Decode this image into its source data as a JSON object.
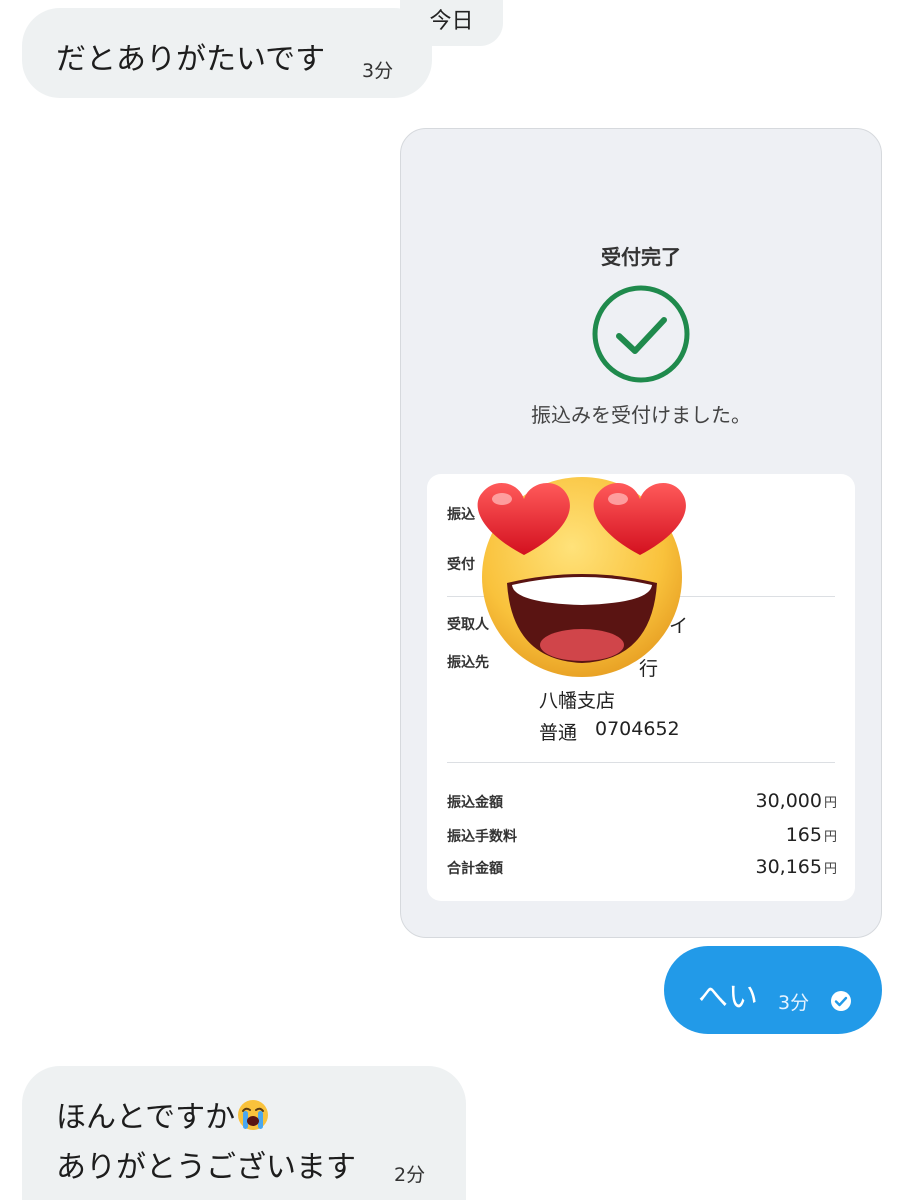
{
  "date_label": "今日",
  "messages": {
    "m1": {
      "text": "だとありがたいです",
      "time": "3分"
    },
    "m2": {
      "text": "へい",
      "time": "3分"
    },
    "m3": {
      "line1": "ほんとですか",
      "line2": "ありがとうございます",
      "time": "2分"
    }
  },
  "receipt": {
    "title": "受付完了",
    "subtitle": "振込みを受付けました。",
    "labels": {
      "transfer_date": "振込",
      "accepted": "受付",
      "recipient": "受取人",
      "destination": "振込先",
      "amount": "振込金額",
      "fee": "振込手数料",
      "total": "合計金額"
    },
    "dest_bank": "行",
    "dest_branch": "八幡支店",
    "dest_account_type": "普通",
    "dest_account": "0704652",
    "amount": "30,000",
    "fee": "165",
    "total": "30,165",
    "yen": "円"
  },
  "icons": {
    "check": "check-circle-icon",
    "emoji": "heart-eyes-emoji",
    "crying": "crying-face-emoji",
    "read": "read-check-icon"
  },
  "colors": {
    "bubble_in": "#eef1f2",
    "bubble_out": "#229ae8",
    "check_green": "#1f8a4c"
  }
}
